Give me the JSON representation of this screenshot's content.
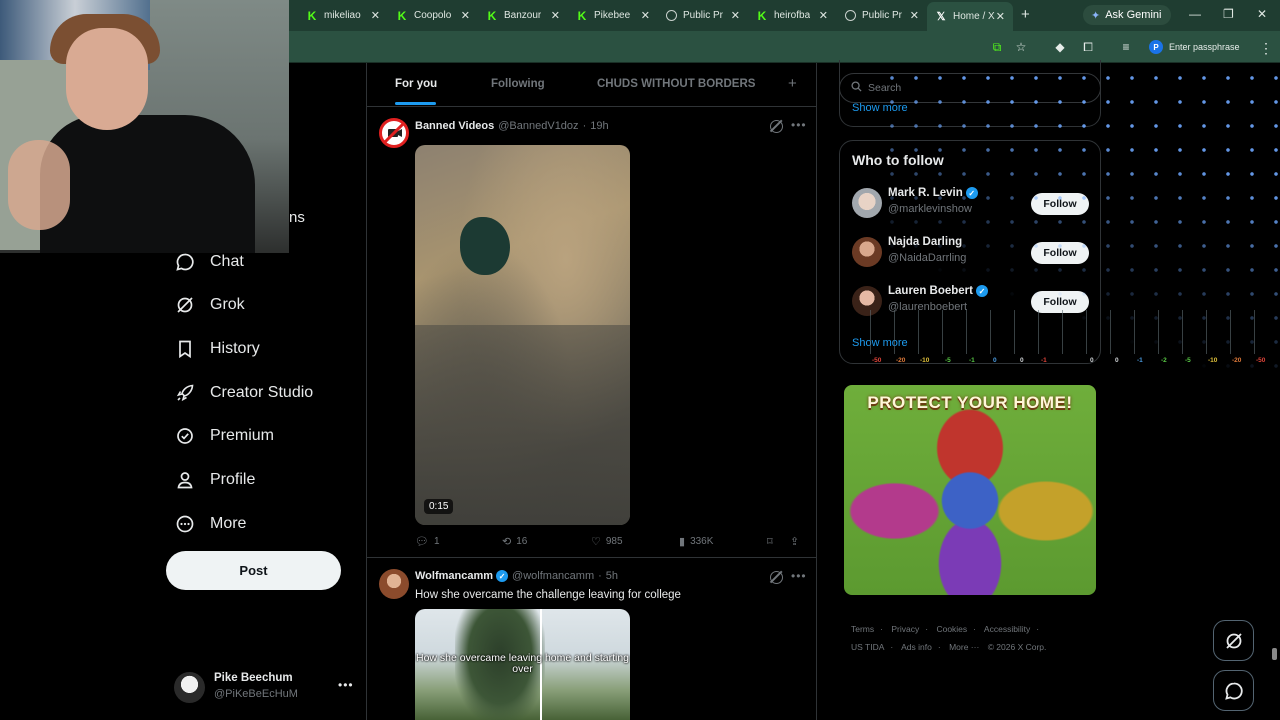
{
  "browser": {
    "tabs": [
      {
        "title": "mikeliao",
        "icon": "kick-icon"
      },
      {
        "title": "Coopolo",
        "icon": "kick-icon"
      },
      {
        "title": "Banzour",
        "icon": "kick-icon"
      },
      {
        "title": "Pikebee",
        "icon": "kick-icon"
      },
      {
        "title": "Public Pr",
        "icon": "globe-icon"
      },
      {
        "title": "heirofba",
        "icon": "kick-icon"
      },
      {
        "title": "Public Pr",
        "icon": "globe-icon"
      },
      {
        "title": "Home / X",
        "icon": "x-icon",
        "active": true
      }
    ],
    "gemini_label": "Ask Gemini",
    "passphrase_label": "Enter passphrase"
  },
  "nav": {
    "partial_label": "ns",
    "items": [
      {
        "label": "Chat",
        "icon": "chat-icon"
      },
      {
        "label": "Grok",
        "icon": "grok-icon"
      },
      {
        "label": "History",
        "icon": "bookmark-icon"
      },
      {
        "label": "Creator Studio",
        "icon": "rocket-icon"
      },
      {
        "label": "Premium",
        "icon": "verified-badge-icon"
      },
      {
        "label": "Profile",
        "icon": "person-icon"
      },
      {
        "label": "More",
        "icon": "more-circle-icon"
      }
    ],
    "post_label": "Post",
    "account": {
      "name": "Pike Beechum",
      "handle": "@PiKeBeEcHuM"
    }
  },
  "timeline": {
    "tabs": [
      "For you",
      "Following",
      "CHUDS WITHOUT BORDERS"
    ],
    "tweets": [
      {
        "name": "Banned Videos",
        "handle": "@BannedV1doz",
        "time": "19h",
        "duration": "0:15",
        "replies": "1",
        "reposts": "16",
        "likes": "985",
        "views": "336K"
      },
      {
        "name": "Wolfmancamm",
        "handle": "@wolfmancamm",
        "time": "5h",
        "text": "How she overcame the challenge leaving for college",
        "caption": "How she overcame leaving home and starting over"
      }
    ]
  },
  "sidebar": {
    "search_placeholder": "Search",
    "show_more_top": "Show more",
    "who_to_follow_title": "Who to follow",
    "people": [
      {
        "name": "Mark R. Levin",
        "handle": "@marklevinshow",
        "verified": true,
        "button": "Follow"
      },
      {
        "name": "Najda Darling",
        "handle": "@NaidaDarrling",
        "verified": false,
        "button": "Follow"
      },
      {
        "name": "Lauren Boebert",
        "handle": "@laurenboebert",
        "verified": true,
        "button": "Follow"
      }
    ],
    "show_more": "Show more",
    "ad_headline": "PROTECT YOUR HOME!",
    "footer": [
      "Terms",
      "Privacy",
      "Cookies",
      "Accessibility",
      "US TIDA",
      "Ads info",
      "More ···",
      "© 2026 X Corp."
    ]
  },
  "meter_labels": [
    "-50",
    "-20",
    "-10",
    "-5",
    "-1",
    "0",
    "0",
    "-1",
    "0",
    "0",
    "-1",
    "-2",
    "-5",
    "-10",
    "-20",
    "-50"
  ],
  "colors": {
    "accent": "#1d9bf0",
    "bg": "#000000",
    "chrome": "#2b5141"
  }
}
